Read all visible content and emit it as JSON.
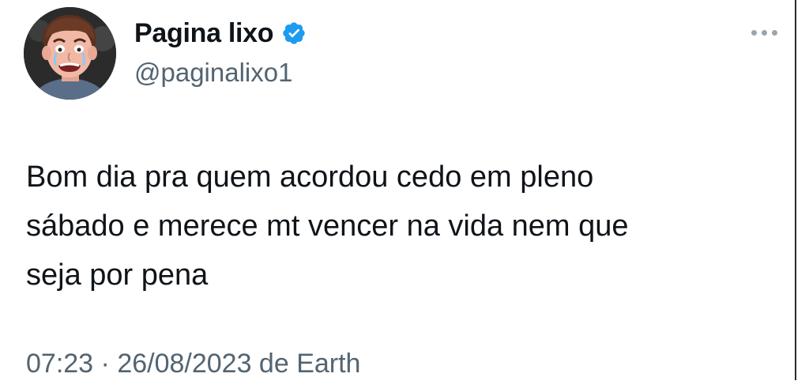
{
  "author": {
    "display_name": "Pagina lixo",
    "handle": "@paginalixo1",
    "verified": true,
    "avatar_icon": "crying-cartoon-face-avatar",
    "verified_icon": "verified-badge-icon",
    "verified_color": "#1d9bf0"
  },
  "tweet": {
    "text": "Bom dia pra quem acordou cedo em pleno\nsábado e merece mt vencer na vida nem que\nseja por pena",
    "time": "07:23",
    "separator": " · ",
    "date": "26/08/2023",
    "source_prefix": " de ",
    "source": "Earth"
  },
  "menu": {
    "more_icon": "more-options-icon"
  },
  "colors": {
    "text_primary": "#0f1419",
    "text_secondary": "#536471",
    "background": "#ffffff"
  }
}
